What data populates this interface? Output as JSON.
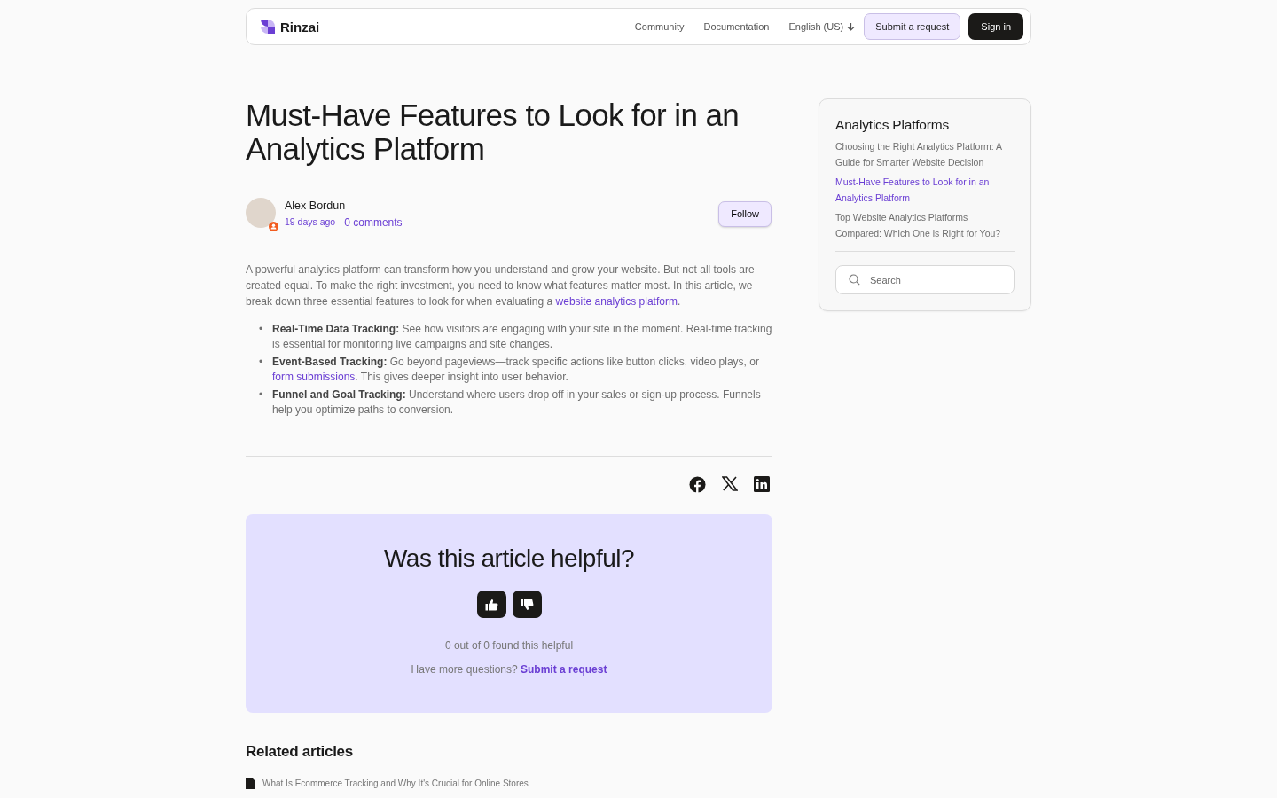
{
  "header": {
    "logo_text": "Rinzai",
    "nav": [
      {
        "label": "Community"
      },
      {
        "label": "Documentation"
      }
    ],
    "language": "English (US)",
    "submit_button": "Submit a request",
    "signin_button": "Sign in"
  },
  "article": {
    "title": "Must-Have Features to Look for in an Analytics Platform",
    "author": {
      "name": "Alex Bordun",
      "posted": "19 days ago",
      "comments": "0 comments"
    },
    "follow_button": "Follow",
    "intro": [
      {
        "kind": "text",
        "text": "A powerful analytics platform can transform how you understand and grow your website. But not all tools are created equal. To make the right investment, you need to know what features matter most. In this article, we break down three essential features to look for when evaluating a "
      },
      {
        "kind": "link",
        "text": "website analytics platform"
      },
      {
        "kind": "text",
        "text": "."
      }
    ],
    "features": [
      {
        "marker": "•",
        "term": "Real-Time Data Tracking:",
        "segments": [
          {
            "kind": "text",
            "text": " See how visitors are engaging with your site in the moment. Real-time tracking is essential for monitoring live campaigns and site changes."
          }
        ]
      },
      {
        "marker": "•",
        "term": "Event-Based Tracking:",
        "segments": [
          {
            "kind": "text",
            "text": " Go beyond pageviews—track specific actions like button clicks, video plays, or "
          },
          {
            "kind": "link",
            "text": "form submissions"
          },
          {
            "kind": "text",
            "text": ". This gives deeper insight into user behavior."
          }
        ]
      },
      {
        "marker": "•",
        "term": "Funnel and Goal Tracking:",
        "segments": [
          {
            "kind": "text",
            "text": " Understand where users drop off in your sales or sign-up process. Funnels help you optimize paths to conversion."
          }
        ]
      }
    ]
  },
  "feedback": {
    "question": "Was this article helpful?",
    "votes_summary": "0 out of 0 found this helpful",
    "more_questions": "Have more questions?",
    "submit_link": "Submit a request"
  },
  "related": {
    "title": "Related articles",
    "items": [
      {
        "title": "What Is Ecommerce Tracking and Why It's Crucial for Online Stores"
      }
    ]
  },
  "sidebar": {
    "title": "Analytics Platforms",
    "items": [
      {
        "label": "Choosing the Right Analytics Platform: A Guide for Smarter Website Decision",
        "selected": false
      },
      {
        "label": "Must-Have Features to Look for in an Analytics Platform",
        "selected": true
      },
      {
        "label": "Top Website Analytics Platforms Compared: Which One is Right for You?",
        "selected": false
      }
    ],
    "search": {
      "placeholder": "Search"
    }
  }
}
